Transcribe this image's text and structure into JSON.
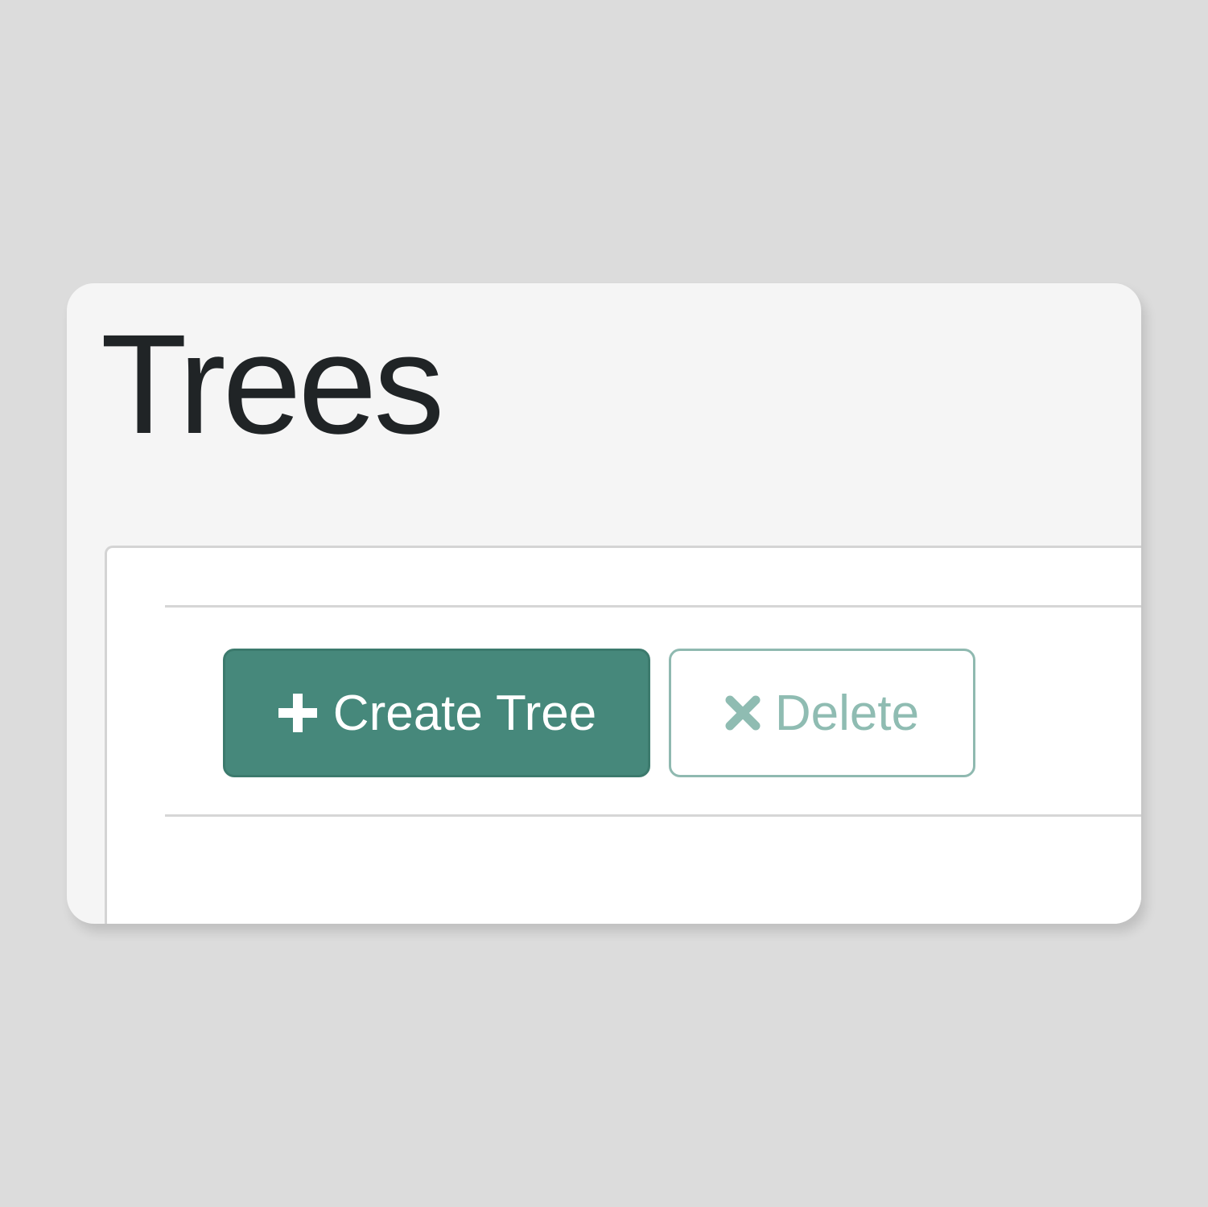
{
  "page": {
    "title": "Trees"
  },
  "toolbar": {
    "create_label": "Create Tree",
    "create_icon": "plus-icon",
    "delete_label": "Delete",
    "delete_icon": "close-icon"
  },
  "colors": {
    "primary": "#46887b",
    "primary_border": "#3c7a6d",
    "delete_text": "#8fbcb2",
    "delete_border": "#8fb9b0",
    "background": "#dcdcdc",
    "card": "#f5f5f5",
    "title_text": "#202426"
  }
}
